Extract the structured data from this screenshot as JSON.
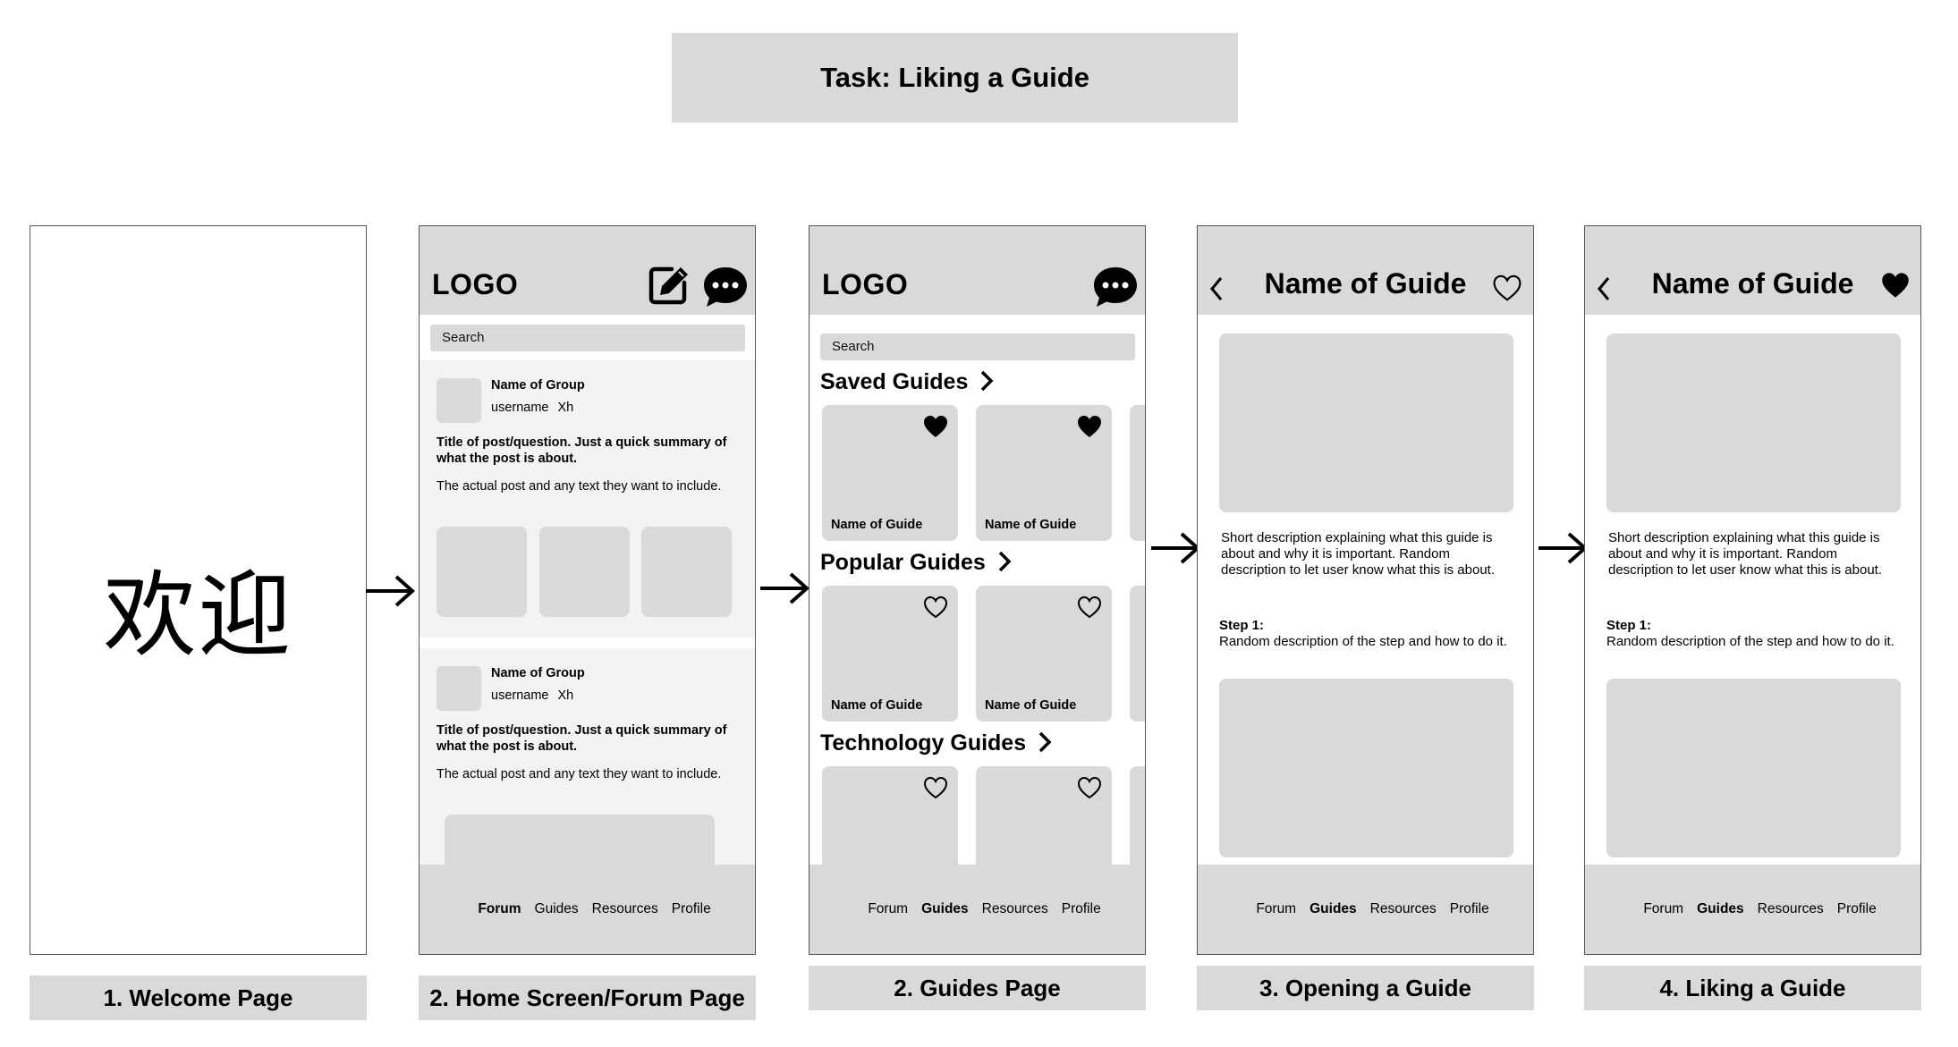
{
  "task_title": "Task: Liking a Guide",
  "screens": {
    "welcome": {
      "text": "欢迎",
      "label": "1. Welcome Page"
    },
    "forum": {
      "label": "2. Home Screen/Forum Page",
      "logo": "LOGO",
      "search_placeholder": "Search",
      "posts": [
        {
          "group": "Name of Group",
          "username": "username",
          "time": "Xh",
          "title": "Title of post/question. Just a quick summary of what the post is about.",
          "body": "The actual post and any text they want to include."
        },
        {
          "group": "Name of Group",
          "username": "username",
          "time": "Xh",
          "title": "Title of post/question. Just a quick summary of what the post is about.",
          "body": "The actual post and any text they want to include."
        }
      ],
      "nav": [
        "Forum",
        "Guides",
        "Resources",
        "Profile"
      ],
      "nav_active": "Forum"
    },
    "guides": {
      "label": "2. Guides Page",
      "logo": "LOGO",
      "search_placeholder": "Search",
      "sections": [
        {
          "title": "Saved Guides",
          "cards": [
            "Name of Guide",
            "Name of Guide"
          ],
          "liked": true
        },
        {
          "title": "Popular Guides",
          "cards": [
            "Name of Guide",
            "Name of Guide"
          ],
          "liked": false
        },
        {
          "title": "Technology Guides",
          "cards": [
            "",
            ""
          ],
          "liked": false
        }
      ],
      "nav": [
        "Forum",
        "Guides",
        "Resources",
        "Profile"
      ],
      "nav_active": "Guides"
    },
    "opening": {
      "label": "3. Opening a Guide",
      "title": "Name of Guide",
      "liked": false,
      "description": "Short description explaining what this guide is about and why it is important. Random description to let user know what this is about.",
      "step_label": "Step 1:",
      "step_description": "Random description of the step and how to do it.",
      "nav": [
        "Forum",
        "Guides",
        "Resources",
        "Profile"
      ],
      "nav_active": "Guides"
    },
    "liking": {
      "label": "4. Liking a Guide",
      "title": "Name of Guide",
      "liked": true,
      "description": "Short description explaining what this guide is about and why it is important. Random description to let user know what this is about.",
      "step_label": "Step 1:",
      "step_description": "Random description of the step and how to do it.",
      "nav": [
        "Forum",
        "Guides",
        "Resources",
        "Profile"
      ],
      "nav_active": "Guides"
    }
  }
}
